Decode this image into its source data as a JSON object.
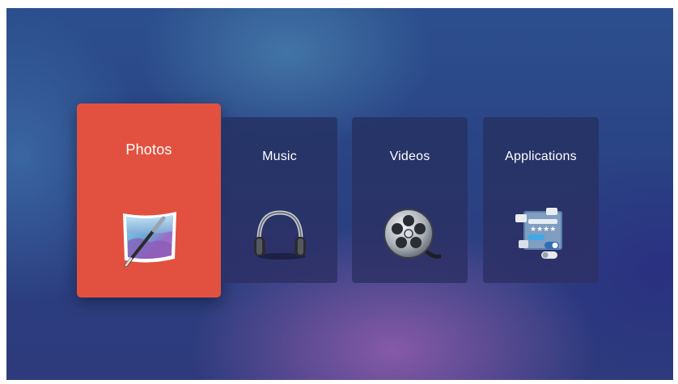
{
  "tiles": [
    {
      "label": "Photos",
      "icon": "photo-edit-icon",
      "selected": true
    },
    {
      "label": "Music",
      "icon": "headphones-icon",
      "selected": false
    },
    {
      "label": "Videos",
      "icon": "film-reel-icon",
      "selected": false
    },
    {
      "label": "Applications",
      "icon": "apps-panel-icon",
      "selected": false
    }
  ],
  "colors": {
    "selected_tile": "#e2513f",
    "tile": "#263466",
    "text": "#ffffff"
  }
}
